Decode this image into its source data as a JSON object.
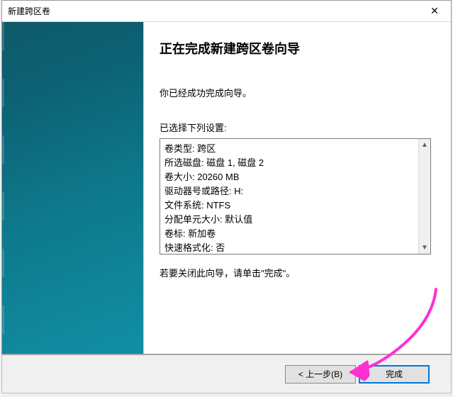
{
  "window": {
    "title": "新建跨区卷",
    "close_glyph": "✕"
  },
  "heading": "正在完成新建跨区卷向导",
  "success_msg": "你已经成功完成向导。",
  "settings_label": "已选择下列设置:",
  "settings": {
    "line0": "卷类型: 跨区",
    "line1": "所选磁盘: 磁盘 1, 磁盘 2",
    "line2": "卷大小: 20260 MB",
    "line3": "驱动器号或路径: H:",
    "line4": "文件系统: NTFS",
    "line5": "分配单元大小: 默认值",
    "line6": "卷标: 新加卷",
    "line7": "快速格式化: 否"
  },
  "close_hint": "若要关闭此向导，请单击\"完成\"。",
  "buttons": {
    "back": "< 上一步(B)",
    "finish": "完成"
  },
  "scroll": {
    "up": "▲",
    "down": "▼"
  },
  "annotation": {
    "color": "#ff2fd4"
  }
}
